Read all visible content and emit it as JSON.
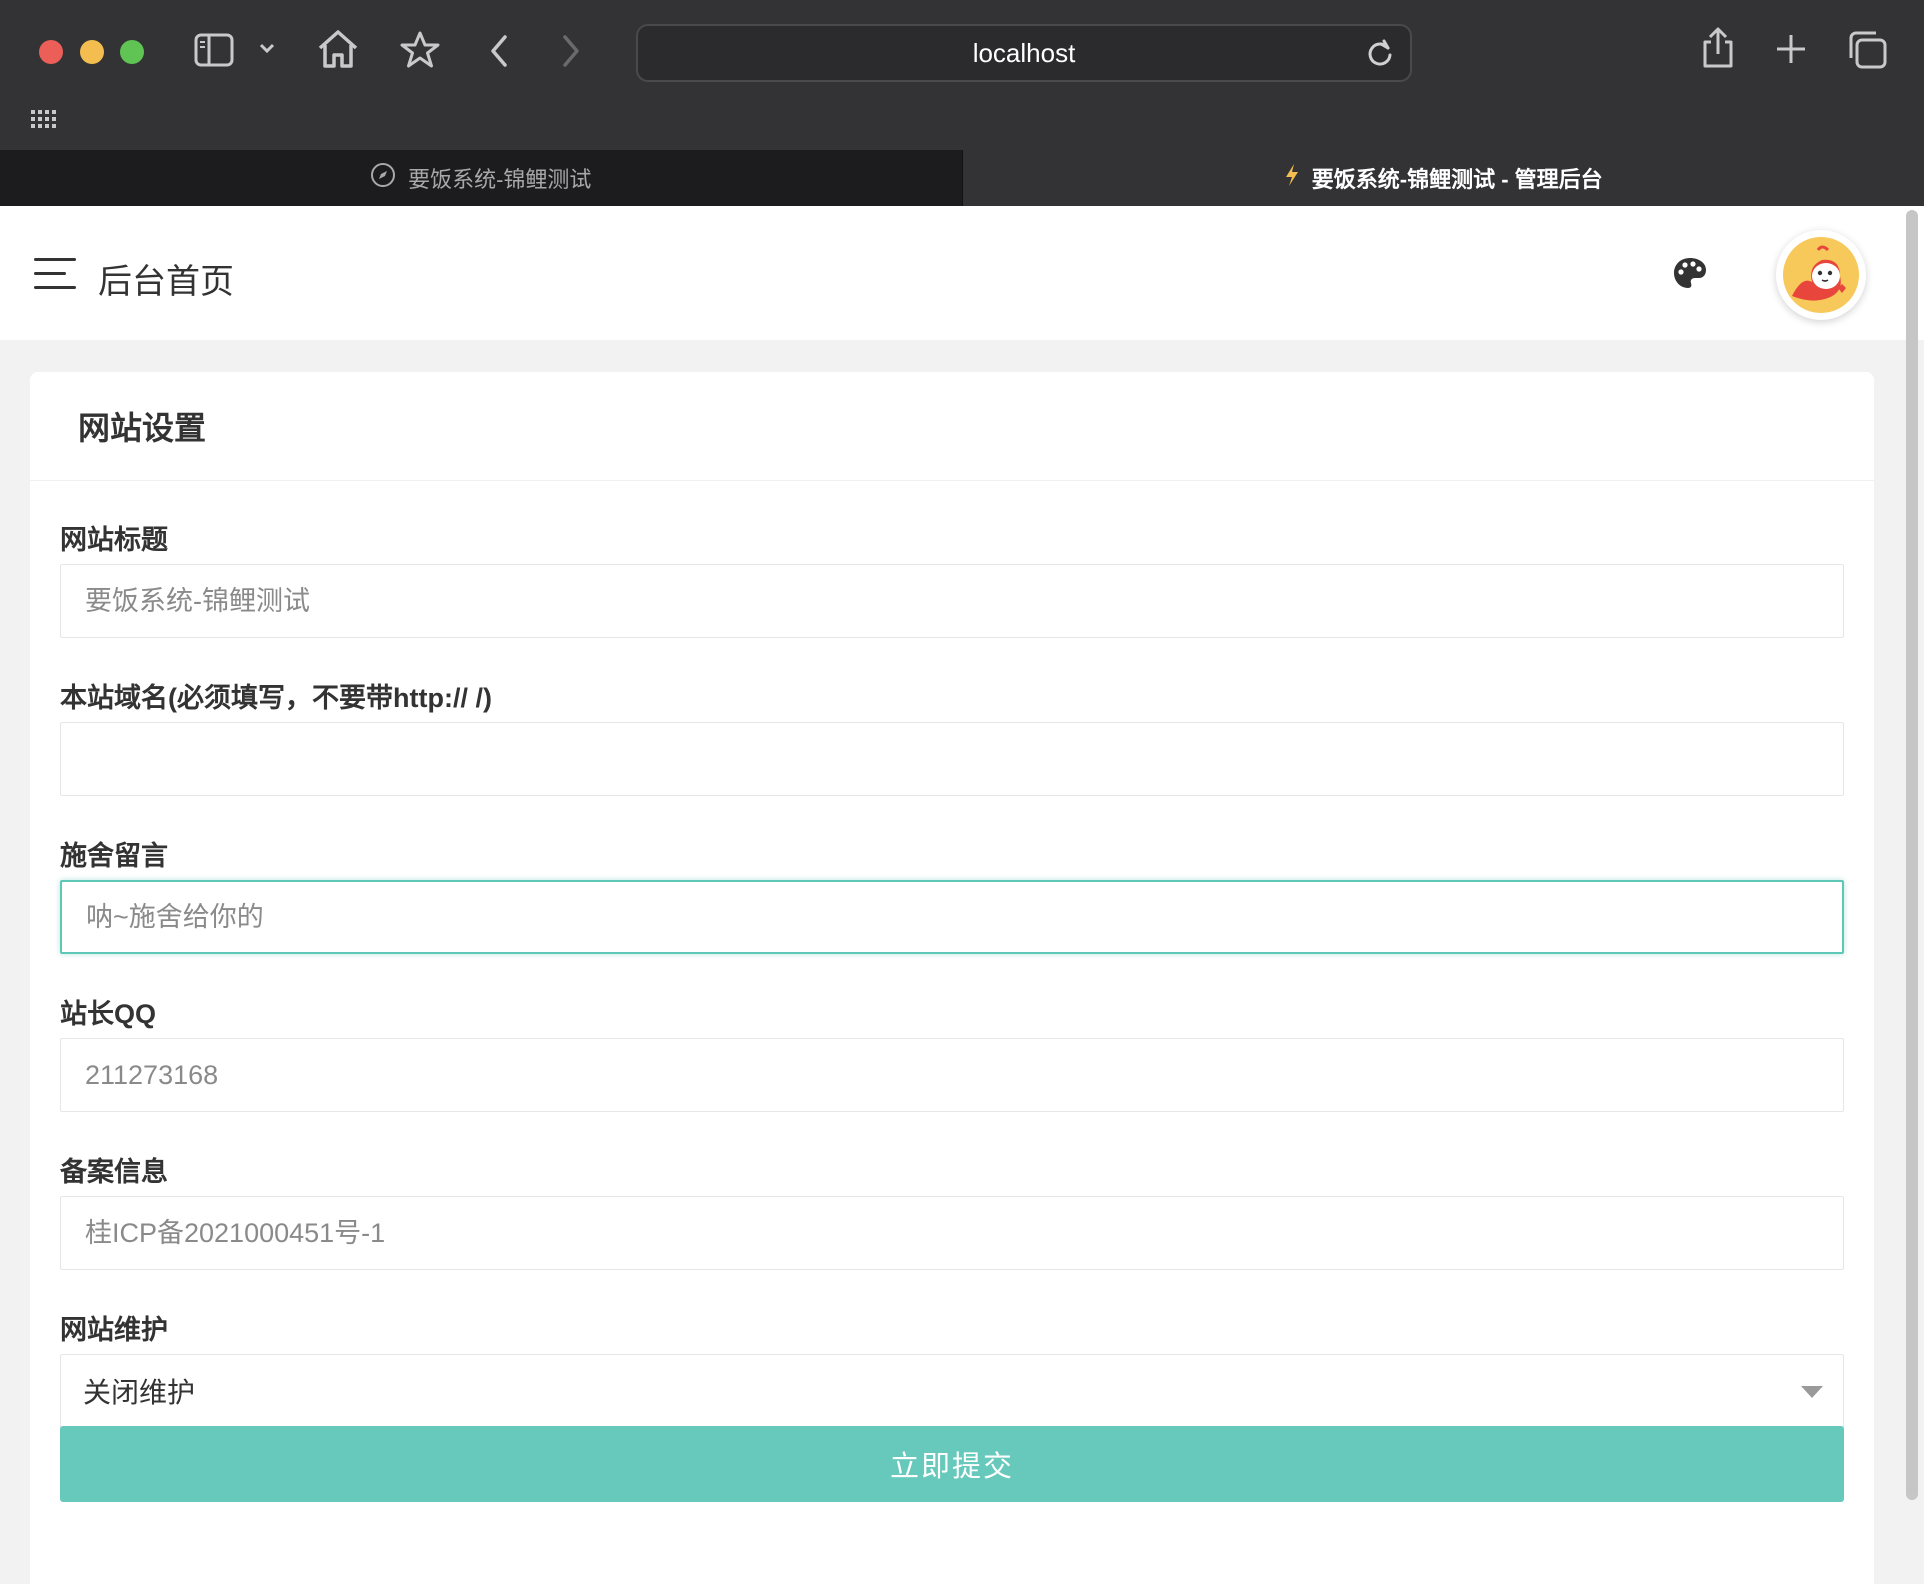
{
  "browser": {
    "address": "localhost",
    "tabs": [
      {
        "title": "要饭系统-锦鲤测试",
        "active": false
      },
      {
        "title": "要饭系统-锦鲤测试 - 管理后台",
        "active": true
      }
    ]
  },
  "header": {
    "title": "后台首页"
  },
  "card": {
    "title": "网站设置"
  },
  "form": {
    "site_title": {
      "label": "网站标题",
      "value": "",
      "placeholder": "要饭系统-锦鲤测试"
    },
    "domain": {
      "label": "本站域名(必须填写，不要带http:// /)",
      "value": "",
      "placeholder": ""
    },
    "message": {
      "label": "施舍留言",
      "value": "",
      "placeholder": "呐~施舍给你的"
    },
    "qq": {
      "label": "站长QQ",
      "value": "",
      "placeholder": "211273168"
    },
    "icp": {
      "label": "备案信息",
      "value": "",
      "placeholder": "桂ICP备2021000451号-1"
    },
    "maintenance": {
      "label": "网站维护",
      "selected": "关闭维护"
    },
    "submit_label": "立即提交"
  },
  "colors": {
    "accent": "#66c9bc",
    "focus_border": "#5fc7b8"
  },
  "icons": [
    "sidebar-icon",
    "chevron-down-icon",
    "home-icon",
    "star-icon",
    "back-icon",
    "forward-icon",
    "reload-icon",
    "share-icon",
    "new-tab-icon",
    "tabs-overview-icon",
    "grid-icon",
    "compass-icon",
    "bolt-icon",
    "menu-icon",
    "palette-icon",
    "avatar"
  ]
}
